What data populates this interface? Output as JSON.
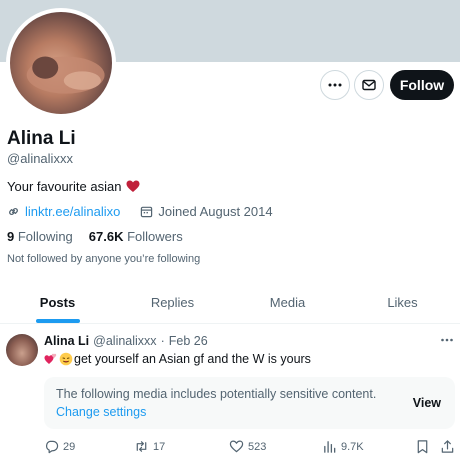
{
  "profile": {
    "name": "Alina Li",
    "handle": "@alinalixxx",
    "bio": "Your favourite asian",
    "link": "linktr.ee/alinalixo",
    "joined": "Joined August 2014",
    "following_count": "9",
    "following_label": "Following",
    "followers_count": "67.6K",
    "followers_label": "Followers",
    "not_followed": "Not followed by anyone you’re following"
  },
  "actions": {
    "follow_label": "Follow"
  },
  "tabs": [
    "Posts",
    "Replies",
    "Media",
    "Likes"
  ],
  "post": {
    "name": "Alina Li",
    "handle": "@alinalixxx",
    "dot": "·",
    "date": "Feb 26",
    "text": "get yourself an Asian gf and the W is yours",
    "sensitive_notice": "The following media includes potentially sensitive content.",
    "change_settings": "Change settings",
    "view_label": "View",
    "replies": "29",
    "reposts": "17",
    "likes": "523",
    "views": "9.7K"
  },
  "colors": {
    "accent": "#1d9bf0",
    "text": "#0f1419",
    "muted": "#536471",
    "heart": "#c0203a"
  },
  "icons": [
    "more-icon",
    "mail-icon",
    "link-icon",
    "calendar-icon",
    "heart-emoji-icon",
    "reply-icon",
    "repost-icon",
    "like-icon",
    "views-icon",
    "bookmark-icon",
    "share-icon"
  ]
}
